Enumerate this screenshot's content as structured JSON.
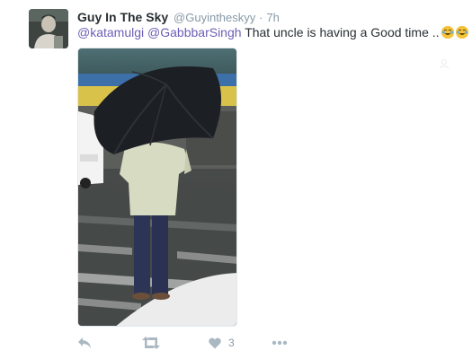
{
  "tweet": {
    "display_name": "Guy In The Sky",
    "handle": "@Guyintheskyy",
    "separator": "·",
    "time": "7h",
    "mention_1": "@katamulgi",
    "mention_2": "@GabbbarSingh",
    "body": "That uncle is having a Good time ..",
    "emojis": [
      "joy-emoji",
      "joy-emoji"
    ]
  },
  "actions": {
    "reply_icon": "reply-icon",
    "retweet_icon": "retweet-icon",
    "like_icon": "heart-icon",
    "like_count": "3",
    "more_icon": "more-icon"
  },
  "colors": {
    "mention": "#6b5fb5",
    "name": "#292f33",
    "secondary": "#8899a6",
    "action_icon": "#aab8c2"
  }
}
